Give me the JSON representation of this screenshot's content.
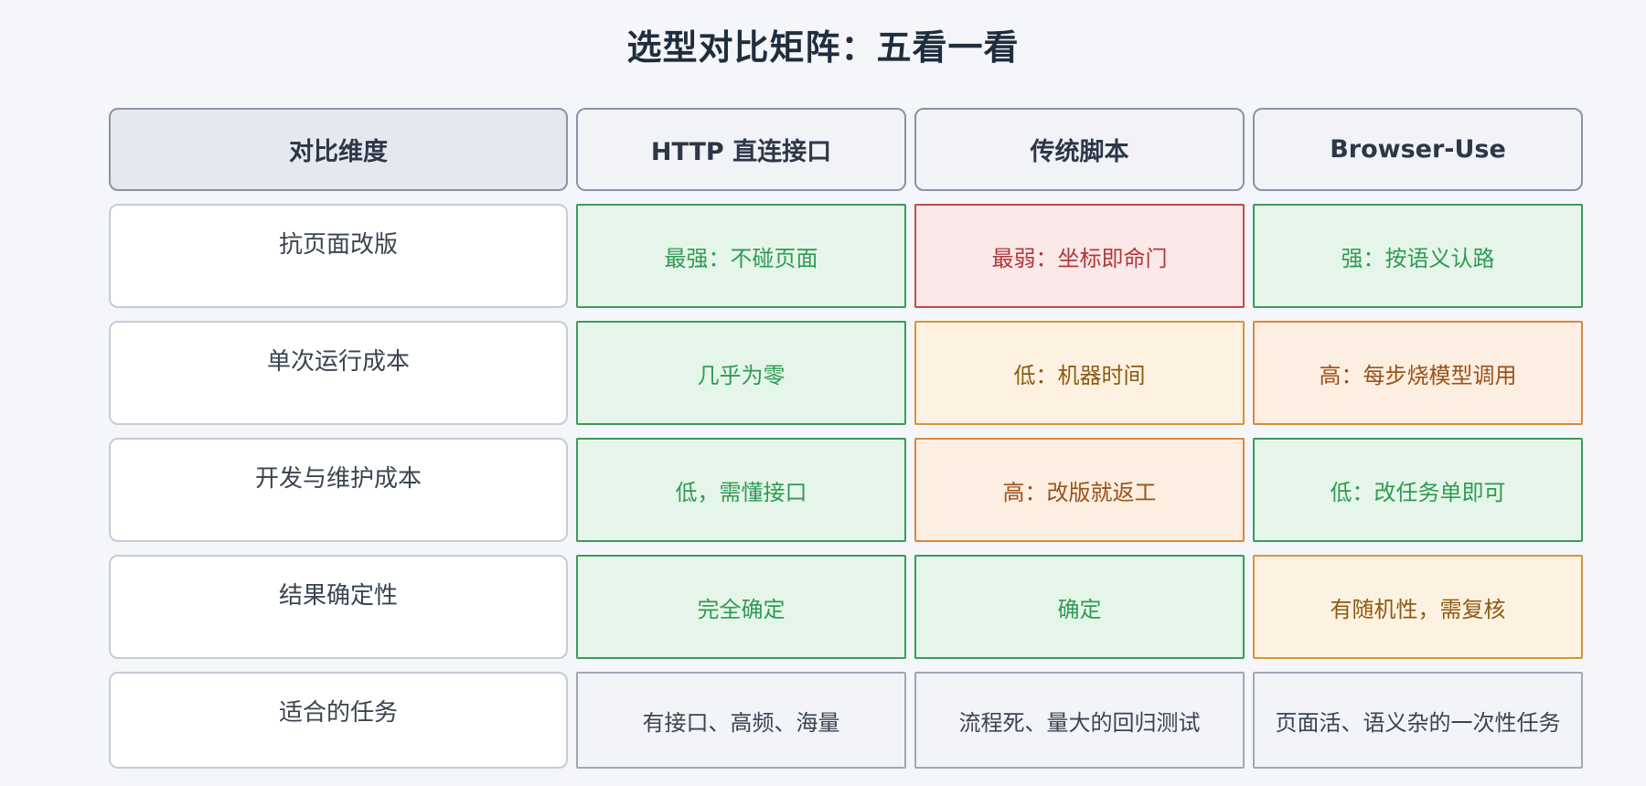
{
  "title": "选型对比矩阵：五看一看",
  "header": {
    "dimension": "对比维度",
    "columns": [
      "HTTP 直连接口",
      "传统脚本",
      "Browser-Use"
    ]
  },
  "rows": [
    {
      "dimension": "抗页面改版",
      "cells": [
        {
          "text": "最强：不碰页面",
          "tone": "good"
        },
        {
          "text": "最弱：坐标即命门",
          "tone": "bad"
        },
        {
          "text": "强：按语义认路",
          "tone": "good"
        }
      ]
    },
    {
      "dimension": "单次运行成本",
      "cells": [
        {
          "text": "几乎为零",
          "tone": "good"
        },
        {
          "text": "低：机器时间",
          "tone": "mid"
        },
        {
          "text": "高：每步烧模型调用",
          "tone": "warn"
        }
      ]
    },
    {
      "dimension": "开发与维护成本",
      "cells": [
        {
          "text": "低，需懂接口",
          "tone": "good"
        },
        {
          "text": "高：改版就返工",
          "tone": "warn"
        },
        {
          "text": "低：改任务单即可",
          "tone": "good"
        }
      ]
    },
    {
      "dimension": "结果确定性",
      "cells": [
        {
          "text": "完全确定",
          "tone": "good"
        },
        {
          "text": "确定",
          "tone": "good"
        },
        {
          "text": "有随机性，需复核",
          "tone": "mid"
        }
      ]
    },
    {
      "dimension": "适合的任务",
      "cells": [
        {
          "text": "有接口、高频、海量",
          "tone": "neutral"
        },
        {
          "text": "流程死、量大的回归测试",
          "tone": "neutral"
        },
        {
          "text": "页面活、语义杂的一次性任务",
          "tone": "neutral"
        }
      ]
    }
  ],
  "colors": {
    "good": "#2f9b52",
    "bad": "#b03a3a",
    "mid": "#8d5a14",
    "warn": "#9a5218",
    "neutral": "#3a4452"
  }
}
